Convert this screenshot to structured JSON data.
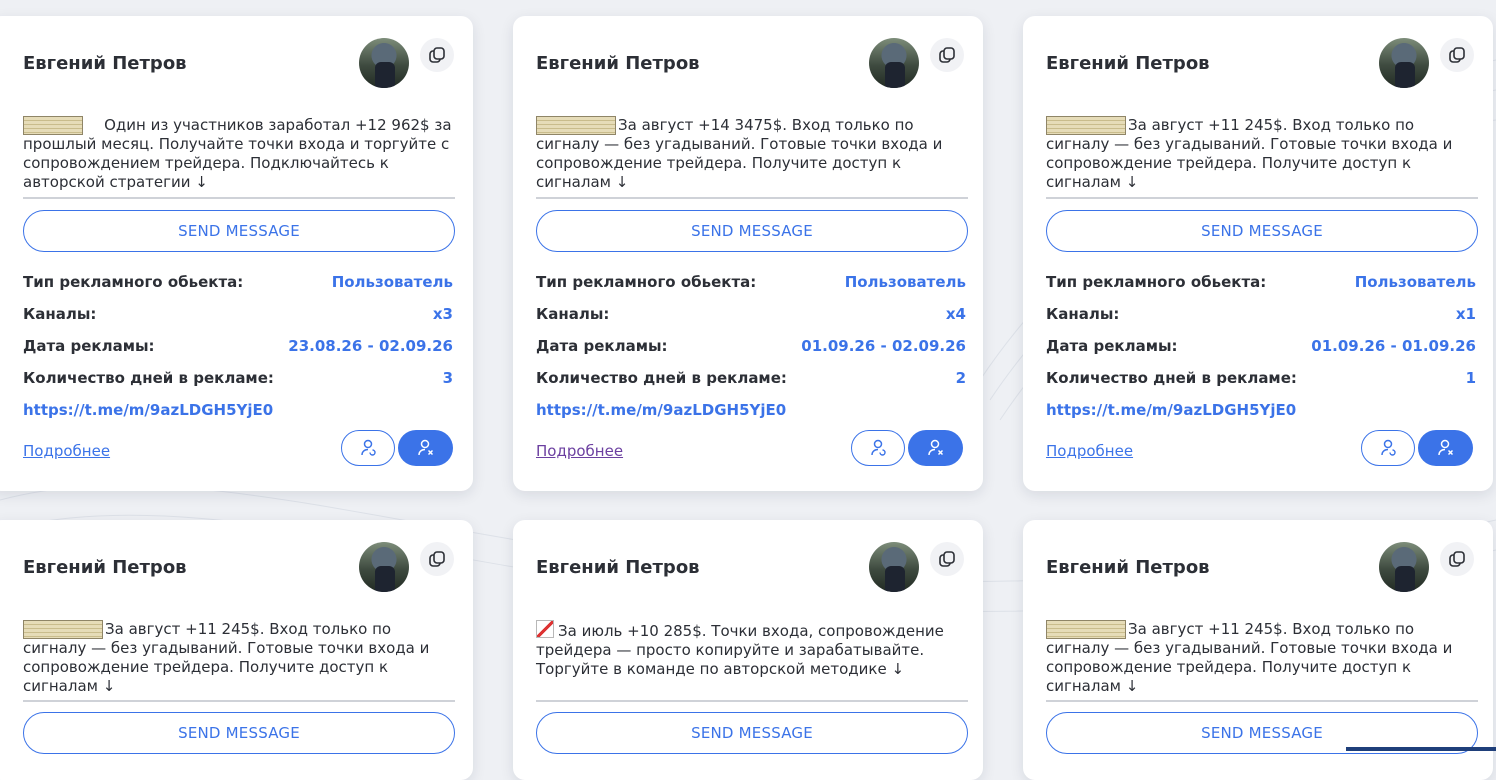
{
  "cards": [
    {
      "name": "Евгений Петров",
      "message": "Один из участников заработал +12 962$ за прошлый месяц. Получайте точки входа и торгуйте с сопровождением трейдера. Подключайтесь к авторской стратегии ↓",
      "send_label": "SEND MESSAGE",
      "fields": [
        {
          "label": "Тип рекламного обьекта:",
          "value": "Пользователь"
        },
        {
          "label": "Каналы:",
          "value": "x3"
        },
        {
          "label": "Дата рекламы:",
          "value": "23.08.26 - 02.09.26"
        },
        {
          "label": "Количество дней в рекламе:",
          "value": "3"
        }
      ],
      "link": "https://t.me/m/9azLDGH5YjE0",
      "more_label": "Подробнее"
    },
    {
      "name": "Евгений Петров",
      "message": "За август +14 3475$. Вход только по сигналу — без угадываний. Готовые точки входа и сопровождение трейдера. Получите доступ к сигналам ↓",
      "send_label": "SEND MESSAGE",
      "fields": [
        {
          "label": "Тип рекламного обьекта:",
          "value": "Пользователь"
        },
        {
          "label": "Каналы:",
          "value": "x4"
        },
        {
          "label": "Дата рекламы:",
          "value": "01.09.26 - 02.09.26"
        },
        {
          "label": "Количество дней в рекламе:",
          "value": "2"
        }
      ],
      "link": "https://t.me/m/9azLDGH5YjE0",
      "more_label": "Подробнее"
    },
    {
      "name": "Евгений Петров",
      "message": "За август +11 245$. Вход только по сигналу — без угадываний. Готовые точки входа и сопровождение трейдера. Получите доступ к сигналам ↓",
      "send_label": "SEND MESSAGE",
      "fields": [
        {
          "label": "Тип рекламного обьекта:",
          "value": "Пользователь"
        },
        {
          "label": "Каналы:",
          "value": "x1"
        },
        {
          "label": "Дата рекламы:",
          "value": "01.09.26 - 01.09.26"
        },
        {
          "label": "Количество дней в рекламе:",
          "value": "1"
        }
      ],
      "link": "https://t.me/m/9azLDGH5YjE0",
      "more_label": "Подробнее"
    },
    {
      "name": "Евгений Петров",
      "message": "За август +11 245$. Вход только по сигналу — без угадываний. Готовые точки входа и сопровождение трейдера. Получите доступ к сигналам ↓",
      "send_label": "SEND MESSAGE"
    },
    {
      "name": "Евгений Петров",
      "message": "За июль +10 285$. Точки входа, сопровождение трейдера — просто копируйте и зарабатывайте. Торгуйте в команде по авторской методике ↓",
      "send_label": "SEND MESSAGE"
    },
    {
      "name": "Евгений Петров",
      "message": "За август +11 245$. Вход только по сигналу — без угадываний. Готовые точки входа и сопровождение трейдера. Получите доступ к сигналам ↓",
      "send_label": "SEND MESSAGE"
    }
  ],
  "icons": {
    "copy": "copy-icon",
    "avatar": "avatar",
    "user_refresh": "user-refresh-icon",
    "user_remove": "user-remove-icon",
    "money_emoji": "money-stack-icon",
    "chart_emoji": "chart-increasing-icon"
  },
  "colors": {
    "accent": "#3b73e8",
    "text": "#2c2f36",
    "visited_link": "#6b3fa0",
    "background": "#eef0f4"
  }
}
